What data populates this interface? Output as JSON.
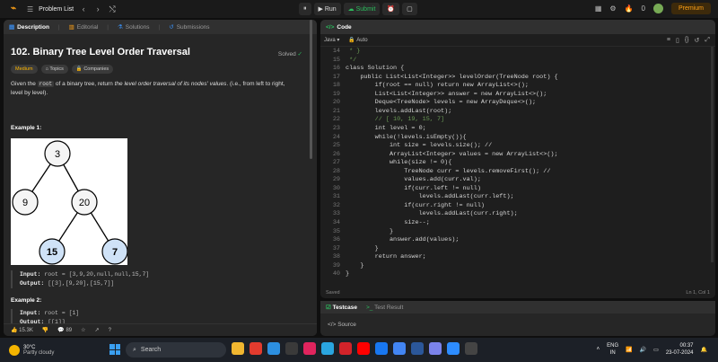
{
  "topbar": {
    "title": "Problem List",
    "run_label": "Run",
    "submit_label": "Submit",
    "streak_count": "0",
    "premium_label": "Premium"
  },
  "left": {
    "tabs": [
      "Description",
      "Editorial",
      "Solutions",
      "Submissions"
    ],
    "title": "102. Binary Tree Level Order Traversal",
    "solved": "Solved",
    "badges": [
      "Medium",
      "Topics",
      "Companies"
    ],
    "desc_pre": "Given the ",
    "desc_code": "root",
    "desc_mid": " of a binary tree, return ",
    "desc_italic": "the level order traversal of its nodes' values",
    "desc_post": ". (i.e., from left to right, level by level).",
    "example1_title": "Example 1:",
    "tree_nodes": [
      "3",
      "9",
      "20",
      "15",
      "7"
    ],
    "ex1_input_label": "Input:",
    "ex1_input": "root = [3,9,20,null,null,15,7]",
    "ex1_output_label": "Output:",
    "ex1_output": "[[3],[9,20],[15,7]]",
    "example2_title": "Example 2:",
    "ex2_input_label": "Input:",
    "ex2_input": "root = [1]",
    "ex2_output_label": "Output:",
    "ex2_output": "[[1]]",
    "likes": "15.3K",
    "comments": "89"
  },
  "code": {
    "header": "Code",
    "language": "Java",
    "mode": "Auto",
    "saved": "Saved",
    "cursor": "Ln 1, Col 1",
    "lines": [
      {
        "n": "14",
        "t": " * }"
      },
      {
        "n": "15",
        "t": " */"
      },
      {
        "n": "16",
        "t": "class Solution {"
      },
      {
        "n": "17",
        "t": "    public List<List<Integer>> levelOrder(TreeNode root) {"
      },
      {
        "n": "18",
        "t": "        if(root == null) return new ArrayList<>();"
      },
      {
        "n": "19",
        "t": "        List<List<Integer>> answer = new ArrayList<>();"
      },
      {
        "n": "20",
        "t": "        Deque<TreeNode> levels = new ArrayDeque<>();"
      },
      {
        "n": "21",
        "t": "        levels.addLast(root);"
      },
      {
        "n": "22",
        "t": "        // [ 10, 19, 15, 7]"
      },
      {
        "n": "23",
        "t": "        int level = 0;"
      },
      {
        "n": "24",
        "t": "        while(!levels.isEmpty()){"
      },
      {
        "n": "25",
        "t": "            int size = levels.size(); //"
      },
      {
        "n": "26",
        "t": "            ArrayList<Integer> values = new ArrayList<>();"
      },
      {
        "n": "27",
        "t": "            while(size != 0){"
      },
      {
        "n": "28",
        "t": "                TreeNode curr = levels.removeFirst(); //"
      },
      {
        "n": "29",
        "t": "                values.add(curr.val);"
      },
      {
        "n": "30",
        "t": "                if(curr.left != null)"
      },
      {
        "n": "31",
        "t": "                    levels.addLast(curr.left);"
      },
      {
        "n": "32",
        "t": "                if(curr.right != null)"
      },
      {
        "n": "33",
        "t": "                    levels.addLast(curr.right);"
      },
      {
        "n": "34",
        "t": "                size--;"
      },
      {
        "n": "35",
        "t": "            }"
      },
      {
        "n": "36",
        "t": "            answer.add(values);"
      },
      {
        "n": "37",
        "t": "        }"
      },
      {
        "n": "38",
        "t": "        return answer;"
      },
      {
        "n": "39",
        "t": "    }"
      },
      {
        "n": "40",
        "t": "}"
      }
    ]
  },
  "test": {
    "tab_testcase": "Testcase",
    "tab_result": "Test Result",
    "source": "Source"
  },
  "taskbar": {
    "temp": "30°C",
    "weather": "Partly cloudy",
    "search_placeholder": "Search",
    "lang1": "ENG",
    "lang2": "IN",
    "time": "00:37",
    "date": "23-07-2024"
  }
}
